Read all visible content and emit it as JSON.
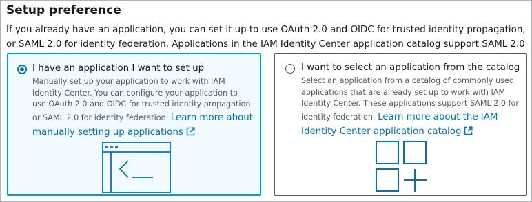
{
  "section": {
    "title": "Setup preference",
    "description": "If you already have an application, you can set it up to use OAuth 2.0 and OIDC for trusted identity propagation, or SAML 2.0 for identity federation. Applications in the IAM Identity Center application catalog support SAML 2.0 only."
  },
  "options": [
    {
      "label": "I have an application I want to set up",
      "selected": true,
      "description": "Manually set up your application to work with IAM Identity Center. You can configure your application to use OAuth 2.0 and OIDC for trusted identity propagation or SAML 2.0 for identity federation.",
      "link": "Learn more about manually setting up applications",
      "icon": "app-window-icon"
    },
    {
      "label": "I want to select an application from the catalog",
      "selected": false,
      "description": "Select an application from a catalog of commonly used applications that are already set up to work with IAM Identity Center. These applications support SAML 2.0 for identity federation.",
      "link": "Learn more about the IAM Identity Center application catalog",
      "icon": "app-catalog-grid-icon"
    }
  ],
  "colors": {
    "link": "#0073bb",
    "selected_border": "#00a1c9",
    "selected_background": "#f1faff",
    "icon_stroke": "#0073bb"
  }
}
